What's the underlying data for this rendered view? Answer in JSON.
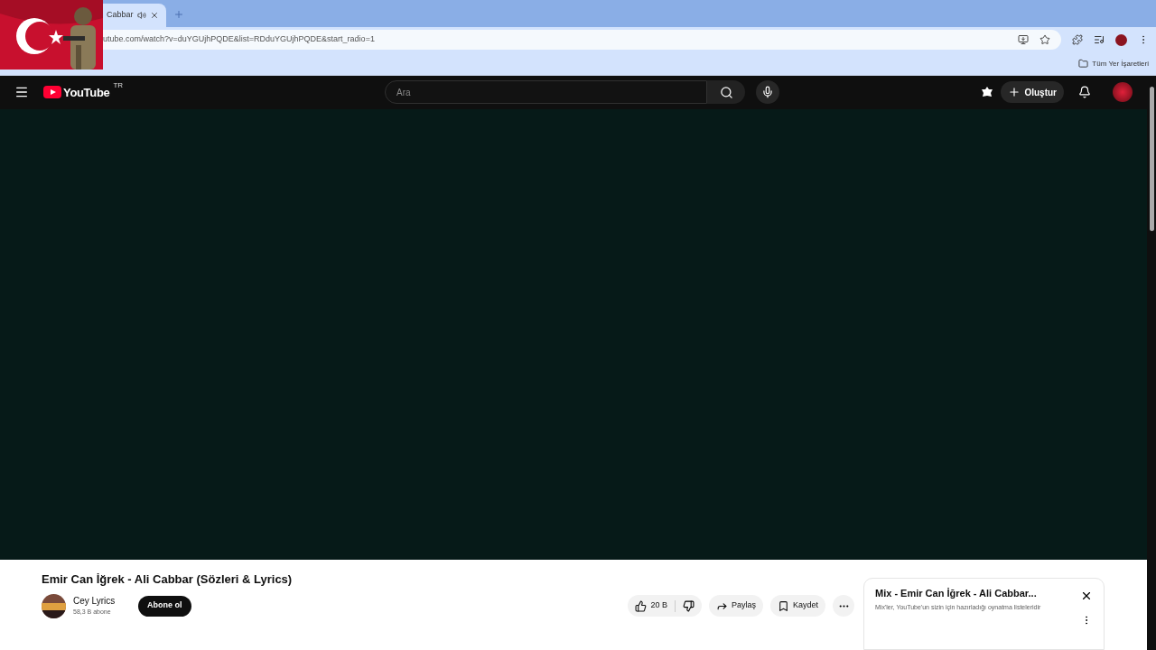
{
  "browser": {
    "tab": {
      "title": "Cabbar"
    },
    "address": "utube.com/watch?v=duYGUjhPQDE&list=RDduYGUjhPQDE&start_radio=1",
    "bookmarks_folder": "Tüm Yer İşaretleri"
  },
  "header": {
    "logo": "YouTube",
    "country": "TR",
    "search": {
      "placeholder": "Ara"
    },
    "create": "Oluştur"
  },
  "video": {
    "title": "Emir Can İğrek - Ali Cabbar (Sözleri & Lyrics)",
    "channel": "Cey Lyrics",
    "subscribers": "58,3 B abone",
    "subscribe": "Abone ol",
    "likes": "20 B",
    "share": "Paylaş",
    "save": "Kaydet"
  },
  "mix": {
    "title": "Mix - Emir Can İğrek - Ali Cabbar...",
    "subtitle": "Mix'ler, YouTube'un sizin için hazırladığı oynatma listeleridir"
  }
}
